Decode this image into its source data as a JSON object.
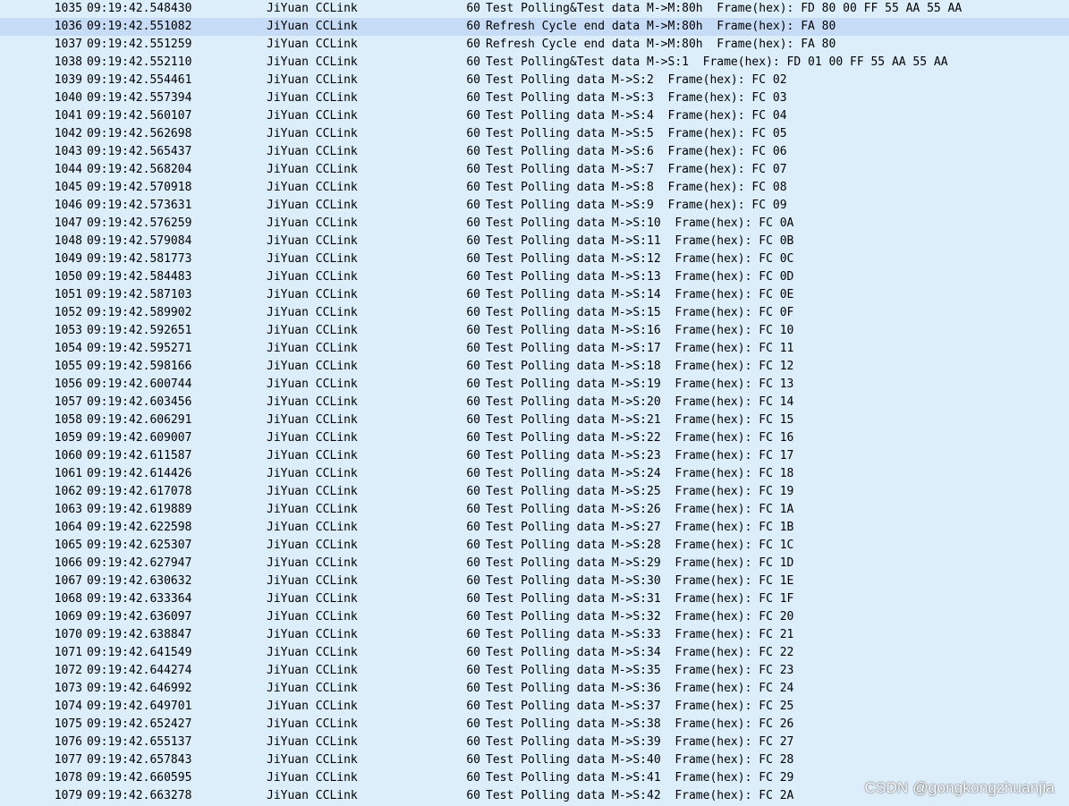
{
  "packets": [
    {
      "no": "1035",
      "time": "09:19:42.548430",
      "source": "JiYuan CCLink",
      "length": "60",
      "info": "Test Polling&Test data M->M:80h  Frame(hex): FD 80 00 FF 55 AA 55 AA"
    },
    {
      "no": "1036",
      "time": "09:19:42.551082",
      "source": "JiYuan CCLink",
      "length": "60",
      "info": "Refresh Cycle end data M->M:80h  Frame(hex): FA 80"
    },
    {
      "no": "1037",
      "time": "09:19:42.551259",
      "source": "JiYuan CCLink",
      "length": "60",
      "info": "Refresh Cycle end data M->M:80h  Frame(hex): FA 80"
    },
    {
      "no": "1038",
      "time": "09:19:42.552110",
      "source": "JiYuan CCLink",
      "length": "60",
      "info": "Test Polling&Test data M->S:1  Frame(hex): FD 01 00 FF 55 AA 55 AA"
    },
    {
      "no": "1039",
      "time": "09:19:42.554461",
      "source": "JiYuan CCLink",
      "length": "60",
      "info": "Test Polling data M->S:2  Frame(hex): FC 02"
    },
    {
      "no": "1040",
      "time": "09:19:42.557394",
      "source": "JiYuan CCLink",
      "length": "60",
      "info": "Test Polling data M->S:3  Frame(hex): FC 03"
    },
    {
      "no": "1041",
      "time": "09:19:42.560107",
      "source": "JiYuan CCLink",
      "length": "60",
      "info": "Test Polling data M->S:4  Frame(hex): FC 04"
    },
    {
      "no": "1042",
      "time": "09:19:42.562698",
      "source": "JiYuan CCLink",
      "length": "60",
      "info": "Test Polling data M->S:5  Frame(hex): FC 05"
    },
    {
      "no": "1043",
      "time": "09:19:42.565437",
      "source": "JiYuan CCLink",
      "length": "60",
      "info": "Test Polling data M->S:6  Frame(hex): FC 06"
    },
    {
      "no": "1044",
      "time": "09:19:42.568204",
      "source": "JiYuan CCLink",
      "length": "60",
      "info": "Test Polling data M->S:7  Frame(hex): FC 07"
    },
    {
      "no": "1045",
      "time": "09:19:42.570918",
      "source": "JiYuan CCLink",
      "length": "60",
      "info": "Test Polling data M->S:8  Frame(hex): FC 08"
    },
    {
      "no": "1046",
      "time": "09:19:42.573631",
      "source": "JiYuan CCLink",
      "length": "60",
      "info": "Test Polling data M->S:9  Frame(hex): FC 09"
    },
    {
      "no": "1047",
      "time": "09:19:42.576259",
      "source": "JiYuan CCLink",
      "length": "60",
      "info": "Test Polling data M->S:10  Frame(hex): FC 0A"
    },
    {
      "no": "1048",
      "time": "09:19:42.579084",
      "source": "JiYuan CCLink",
      "length": "60",
      "info": "Test Polling data M->S:11  Frame(hex): FC 0B"
    },
    {
      "no": "1049",
      "time": "09:19:42.581773",
      "source": "JiYuan CCLink",
      "length": "60",
      "info": "Test Polling data M->S:12  Frame(hex): FC 0C"
    },
    {
      "no": "1050",
      "time": "09:19:42.584483",
      "source": "JiYuan CCLink",
      "length": "60",
      "info": "Test Polling data M->S:13  Frame(hex): FC 0D"
    },
    {
      "no": "1051",
      "time": "09:19:42.587103",
      "source": "JiYuan CCLink",
      "length": "60",
      "info": "Test Polling data M->S:14  Frame(hex): FC 0E"
    },
    {
      "no": "1052",
      "time": "09:19:42.589902",
      "source": "JiYuan CCLink",
      "length": "60",
      "info": "Test Polling data M->S:15  Frame(hex): FC 0F"
    },
    {
      "no": "1053",
      "time": "09:19:42.592651",
      "source": "JiYuan CCLink",
      "length": "60",
      "info": "Test Polling data M->S:16  Frame(hex): FC 10"
    },
    {
      "no": "1054",
      "time": "09:19:42.595271",
      "source": "JiYuan CCLink",
      "length": "60",
      "info": "Test Polling data M->S:17  Frame(hex): FC 11"
    },
    {
      "no": "1055",
      "time": "09:19:42.598166",
      "source": "JiYuan CCLink",
      "length": "60",
      "info": "Test Polling data M->S:18  Frame(hex): FC 12"
    },
    {
      "no": "1056",
      "time": "09:19:42.600744",
      "source": "JiYuan CCLink",
      "length": "60",
      "info": "Test Polling data M->S:19  Frame(hex): FC 13"
    },
    {
      "no": "1057",
      "time": "09:19:42.603456",
      "source": "JiYuan CCLink",
      "length": "60",
      "info": "Test Polling data M->S:20  Frame(hex): FC 14"
    },
    {
      "no": "1058",
      "time": "09:19:42.606291",
      "source": "JiYuan CCLink",
      "length": "60",
      "info": "Test Polling data M->S:21  Frame(hex): FC 15"
    },
    {
      "no": "1059",
      "time": "09:19:42.609007",
      "source": "JiYuan CCLink",
      "length": "60",
      "info": "Test Polling data M->S:22  Frame(hex): FC 16"
    },
    {
      "no": "1060",
      "time": "09:19:42.611587",
      "source": "JiYuan CCLink",
      "length": "60",
      "info": "Test Polling data M->S:23  Frame(hex): FC 17"
    },
    {
      "no": "1061",
      "time": "09:19:42.614426",
      "source": "JiYuan CCLink",
      "length": "60",
      "info": "Test Polling data M->S:24  Frame(hex): FC 18"
    },
    {
      "no": "1062",
      "time": "09:19:42.617078",
      "source": "JiYuan CCLink",
      "length": "60",
      "info": "Test Polling data M->S:25  Frame(hex): FC 19"
    },
    {
      "no": "1063",
      "time": "09:19:42.619889",
      "source": "JiYuan CCLink",
      "length": "60",
      "info": "Test Polling data M->S:26  Frame(hex): FC 1A"
    },
    {
      "no": "1064",
      "time": "09:19:42.622598",
      "source": "JiYuan CCLink",
      "length": "60",
      "info": "Test Polling data M->S:27  Frame(hex): FC 1B"
    },
    {
      "no": "1065",
      "time": "09:19:42.625307",
      "source": "JiYuan CCLink",
      "length": "60",
      "info": "Test Polling data M->S:28  Frame(hex): FC 1C"
    },
    {
      "no": "1066",
      "time": "09:19:42.627947",
      "source": "JiYuan CCLink",
      "length": "60",
      "info": "Test Polling data M->S:29  Frame(hex): FC 1D"
    },
    {
      "no": "1067",
      "time": "09:19:42.630632",
      "source": "JiYuan CCLink",
      "length": "60",
      "info": "Test Polling data M->S:30  Frame(hex): FC 1E"
    },
    {
      "no": "1068",
      "time": "09:19:42.633364",
      "source": "JiYuan CCLink",
      "length": "60",
      "info": "Test Polling data M->S:31  Frame(hex): FC 1F"
    },
    {
      "no": "1069",
      "time": "09:19:42.636097",
      "source": "JiYuan CCLink",
      "length": "60",
      "info": "Test Polling data M->S:32  Frame(hex): FC 20"
    },
    {
      "no": "1070",
      "time": "09:19:42.638847",
      "source": "JiYuan CCLink",
      "length": "60",
      "info": "Test Polling data M->S:33  Frame(hex): FC 21"
    },
    {
      "no": "1071",
      "time": "09:19:42.641549",
      "source": "JiYuan CCLink",
      "length": "60",
      "info": "Test Polling data M->S:34  Frame(hex): FC 22"
    },
    {
      "no": "1072",
      "time": "09:19:42.644274",
      "source": "JiYuan CCLink",
      "length": "60",
      "info": "Test Polling data M->S:35  Frame(hex): FC 23"
    },
    {
      "no": "1073",
      "time": "09:19:42.646992",
      "source": "JiYuan CCLink",
      "length": "60",
      "info": "Test Polling data M->S:36  Frame(hex): FC 24"
    },
    {
      "no": "1074",
      "time": "09:19:42.649701",
      "source": "JiYuan CCLink",
      "length": "60",
      "info": "Test Polling data M->S:37  Frame(hex): FC 25"
    },
    {
      "no": "1075",
      "time": "09:19:42.652427",
      "source": "JiYuan CCLink",
      "length": "60",
      "info": "Test Polling data M->S:38  Frame(hex): FC 26"
    },
    {
      "no": "1076",
      "time": "09:19:42.655137",
      "source": "JiYuan CCLink",
      "length": "60",
      "info": "Test Polling data M->S:39  Frame(hex): FC 27"
    },
    {
      "no": "1077",
      "time": "09:19:42.657843",
      "source": "JiYuan CCLink",
      "length": "60",
      "info": "Test Polling data M->S:40  Frame(hex): FC 28"
    },
    {
      "no": "1078",
      "time": "09:19:42.660595",
      "source": "JiYuan CCLink",
      "length": "60",
      "info": "Test Polling data M->S:41  Frame(hex): FC 29"
    },
    {
      "no": "1079",
      "time": "09:19:42.663278",
      "source": "JiYuan CCLink",
      "length": "60",
      "info": "Test Polling data M->S:42  Frame(hex): FC 2A"
    }
  ],
  "selected_packet": "1036",
  "watermark": "CSDN @gongkongzhuanjia",
  "colors": {
    "row_background": "#ddeefb",
    "selected_row_background": "#c6dcf6",
    "text": "#000000"
  }
}
